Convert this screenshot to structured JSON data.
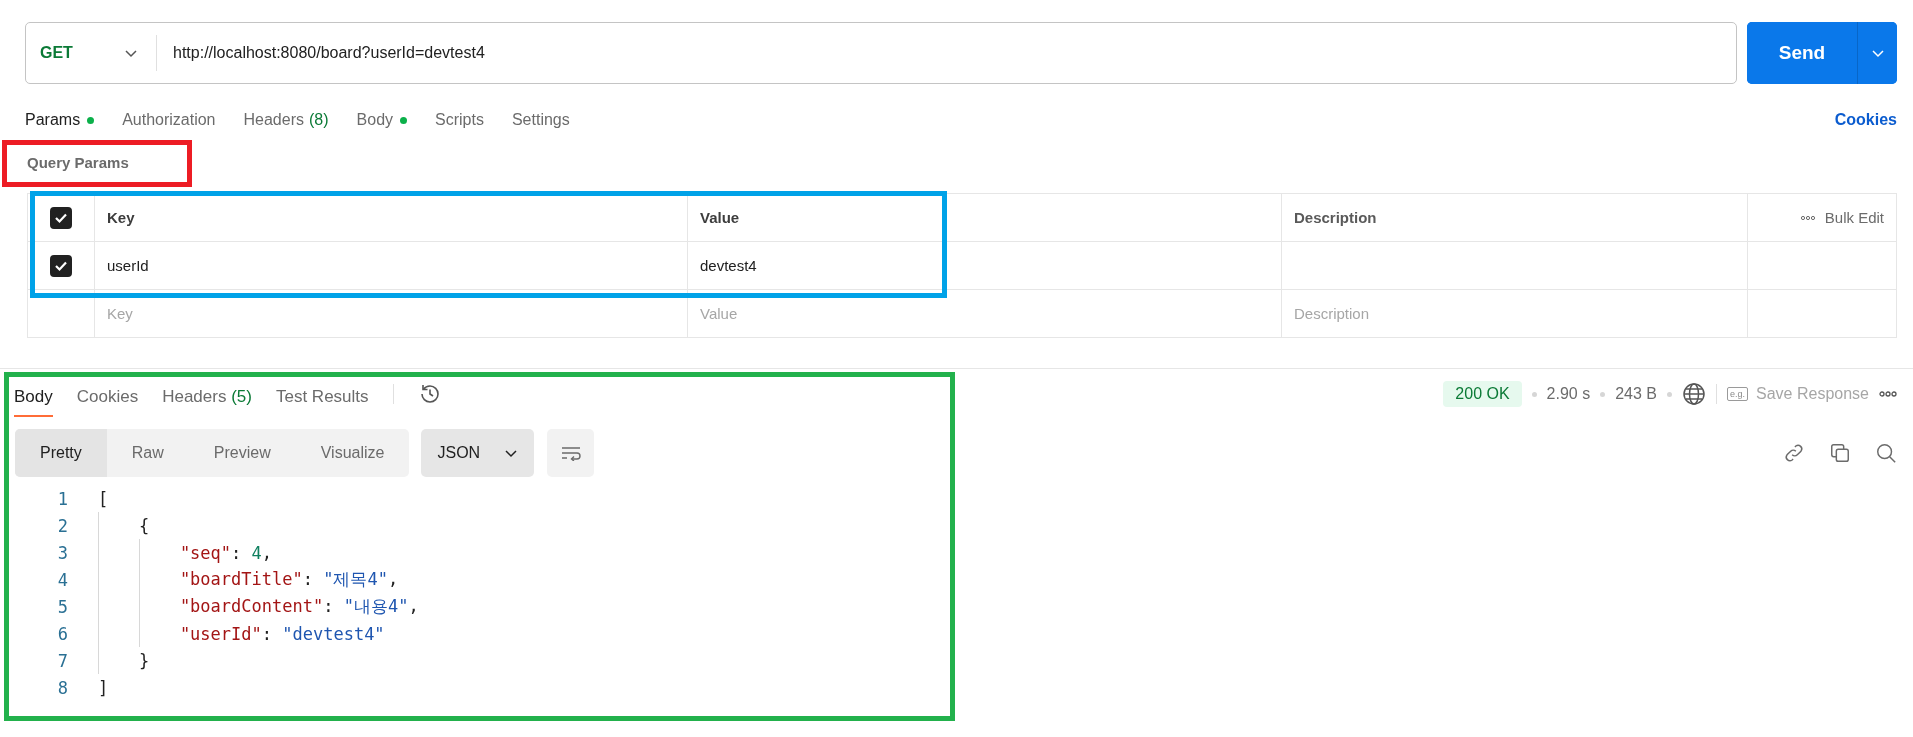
{
  "request": {
    "method": "GET",
    "url": "http://localhost:8080/board?userId=devtest4",
    "send_label": "Send"
  },
  "request_tabs": [
    {
      "label": "Params",
      "has_dot": true,
      "selected": true
    },
    {
      "label": "Authorization",
      "has_dot": false,
      "selected": false
    },
    {
      "label": "Headers",
      "count": "(8)",
      "has_dot": false,
      "selected": false
    },
    {
      "label": "Body",
      "has_dot": true,
      "selected": false
    },
    {
      "label": "Scripts",
      "has_dot": false,
      "selected": false
    },
    {
      "label": "Settings",
      "has_dot": false,
      "selected": false
    }
  ],
  "cookies_link": "Cookies",
  "query_params": {
    "title": "Query Params",
    "select_all_checked": true,
    "columns": [
      "Key",
      "Value",
      "Description"
    ],
    "bulk_edit": "Bulk Edit",
    "rows": [
      {
        "checked": true,
        "key": "userId",
        "value": "devtest4"
      }
    ],
    "placeholder_row": {
      "key": "Key",
      "value": "Value",
      "description": "Description"
    }
  },
  "response": {
    "tabs": [
      {
        "label": "Body",
        "selected": true
      },
      {
        "label": "Cookies",
        "selected": false
      },
      {
        "label": "Headers",
        "count": "(5)",
        "selected": false
      },
      {
        "label": "Test Results",
        "selected": false
      }
    ],
    "status": "200 OK",
    "time": "2.90 s",
    "size": "243 B",
    "save_icon_text": "e.g.",
    "save_label": "Save Response",
    "view_modes": [
      {
        "label": "Pretty",
        "selected": true
      },
      {
        "label": "Raw",
        "selected": false
      },
      {
        "label": "Preview",
        "selected": false
      },
      {
        "label": "Visualize",
        "selected": false
      }
    ],
    "format": "JSON",
    "code_lines": [
      {
        "number": "1",
        "tokens": [
          {
            "kind": "open",
            "text": "["
          }
        ]
      },
      {
        "number": "2",
        "tokens": [
          {
            "kind": "open",
            "text": "{"
          }
        ]
      },
      {
        "number": "3",
        "tokens": [
          {
            "kind": "key",
            "text": "\"seq\""
          },
          {
            "kind": "punct",
            "text": ": "
          },
          {
            "kind": "number",
            "text": "4"
          },
          {
            "kind": "punct",
            "text": ","
          }
        ]
      },
      {
        "number": "4",
        "tokens": [
          {
            "kind": "key",
            "text": "\"boardTitle\""
          },
          {
            "kind": "punct",
            "text": ": "
          },
          {
            "kind": "string",
            "text": "\"제목4\""
          },
          {
            "kind": "punct",
            "text": ","
          }
        ]
      },
      {
        "number": "5",
        "tokens": [
          {
            "kind": "key",
            "text": "\"boardContent\""
          },
          {
            "kind": "punct",
            "text": ": "
          },
          {
            "kind": "string",
            "text": "\"내용4\""
          },
          {
            "kind": "punct",
            "text": ","
          }
        ]
      },
      {
        "number": "6",
        "tokens": [
          {
            "kind": "key",
            "text": "\"userId\""
          },
          {
            "kind": "punct",
            "text": ": "
          },
          {
            "kind": "string",
            "text": "\"devtest4\""
          }
        ]
      },
      {
        "number": "7",
        "tokens": [
          {
            "kind": "close",
            "text": "}"
          }
        ]
      },
      {
        "number": "8",
        "tokens": [
          {
            "kind": "close",
            "text": "]"
          }
        ]
      }
    ]
  },
  "annotations": [
    {
      "kind": "title",
      "color": "#ed1c24"
    },
    {
      "kind": "table",
      "color": "#00a2e8"
    },
    {
      "kind": "response",
      "color": "#22b14c"
    }
  ]
}
